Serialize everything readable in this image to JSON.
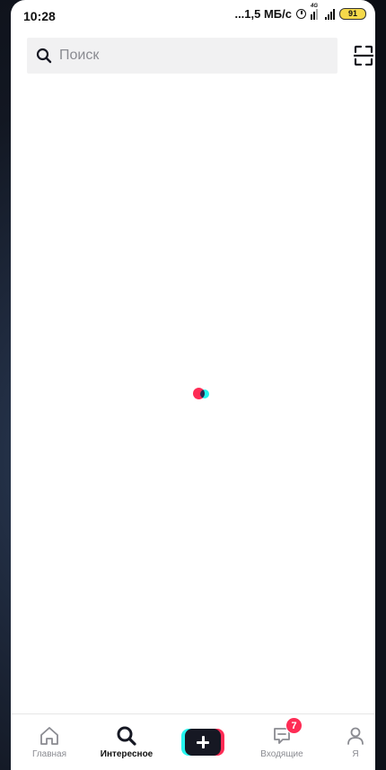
{
  "status_bar": {
    "time": "10:28",
    "net_speed": "...1,5 МБ/с",
    "network_type": "4G",
    "battery": "91"
  },
  "search": {
    "placeholder": "Поиск"
  },
  "icons": {
    "search": "search-icon",
    "scan": "scan-icon",
    "home": "home-icon",
    "discover": "search-icon",
    "create": "plus-icon",
    "inbox": "inbox-icon",
    "profile": "profile-icon"
  },
  "bottom_nav": {
    "items": [
      {
        "label": "Главная",
        "active": false
      },
      {
        "label": "Интересное",
        "active": true
      },
      {
        "label": "",
        "active": false
      },
      {
        "label": "Входящие",
        "active": false,
        "badge": "7"
      },
      {
        "label": "Я",
        "active": false
      }
    ]
  },
  "colors": {
    "accent_red": "#fe2c55",
    "accent_cyan": "#25f4ee",
    "battery": "#f5d94a"
  }
}
